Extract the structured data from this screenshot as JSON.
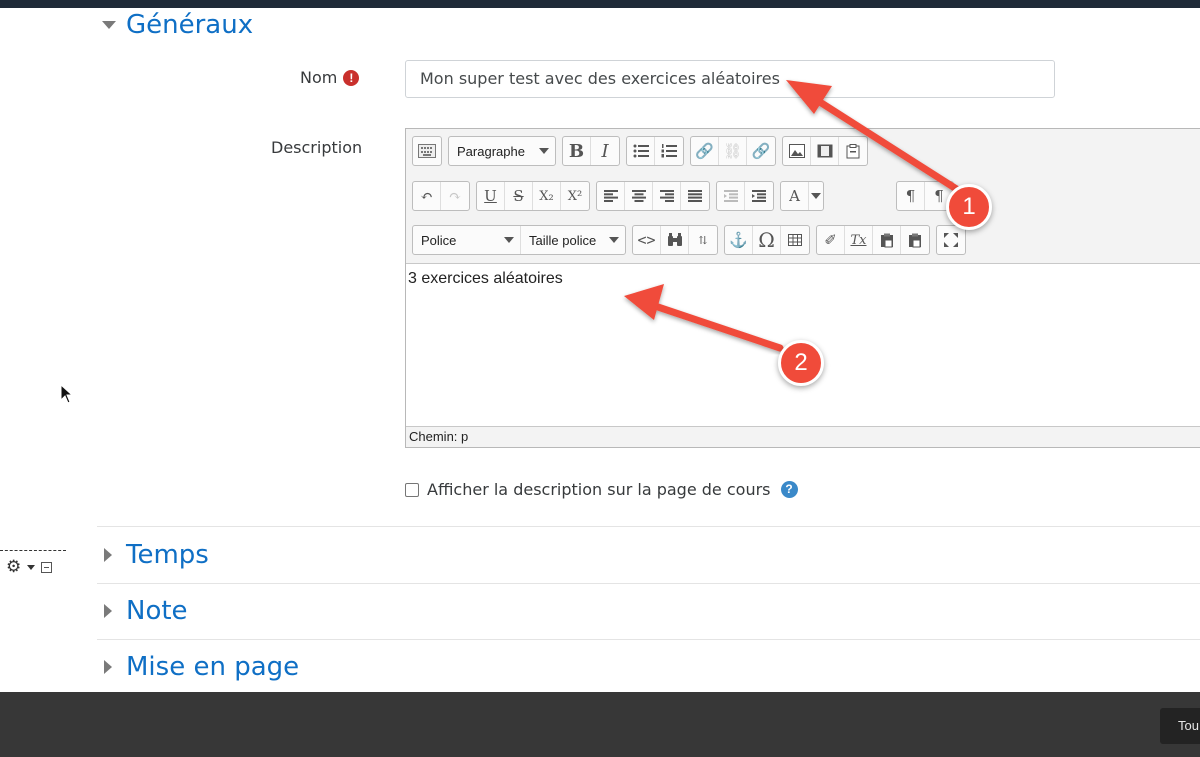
{
  "colors": {
    "accent": "#0f6fc5",
    "required": "#c9302c",
    "help": "#3a89c9",
    "annotation": "#f04b3a",
    "footer": "#373737"
  },
  "sections": {
    "generaux": "Généraux",
    "temps": "Temps",
    "note": "Note",
    "mise_en_page": "Mise en page"
  },
  "form": {
    "name_label": "Nom",
    "required_icon": "!",
    "name_value": "Mon super test avec des exercices aléatoires",
    "description_label": "Description"
  },
  "editor": {
    "format_select": "Paragraphe",
    "font_select": "Police",
    "size_select": "Taille police",
    "content": "3 exercices aléatoires",
    "status_path": "Chemin: p",
    "buttons": {
      "bold": "B",
      "italic": "I",
      "underline": "U",
      "strike": "S",
      "subscript": "X₂",
      "superscript": "X²",
      "font_color": "A",
      "omega": "Ω",
      "clear": "Tx"
    }
  },
  "checkbox": {
    "label": "Afficher la description sur la page de cours",
    "help_icon": "?"
  },
  "footer": {
    "button_label": "Tou"
  },
  "annotations": {
    "badge_1": "1",
    "badge_2": "2"
  },
  "icons": [
    "required-icon",
    "help-icon",
    "gear-icon",
    "collapse-icon",
    "cursor-icon",
    "toolbar-toggle-icon",
    "list-icon",
    "link-icon",
    "image-icon",
    "undo-icon",
    "redo-icon",
    "align-icon",
    "indent-icon",
    "paragraph-icon",
    "code-icon",
    "find-icon",
    "anchor-icon",
    "table-icon",
    "eraser-icon",
    "paste-icon",
    "fullscreen-icon"
  ]
}
